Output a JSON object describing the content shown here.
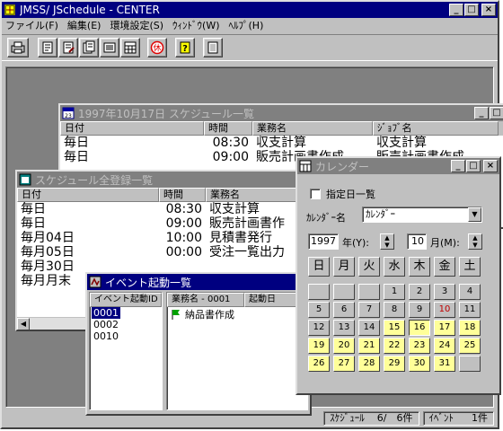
{
  "app": {
    "title": "JMSS/ JSchedule - CENTER",
    "menu": [
      "ファイル(F)",
      "編集(E)",
      "環境設定(S)",
      "ｳｨﾝﾄﾞｳ(W)",
      "ﾍﾙﾌﾟ(H)"
    ],
    "toolbar_icons": [
      "print-icon",
      "new-schedule-icon",
      "edit-schedule-icon",
      "list-schedule-icon",
      "register-icon",
      "calendar-icon",
      "holiday-icon",
      "help-icon",
      "memo-icon"
    ]
  },
  "schedule_list": {
    "title": "1997年10月17日 スケジュール一覧",
    "columns": [
      "日付",
      "時間",
      "業務名",
      "ｼﾞｮﾌﾞ名"
    ],
    "rows": [
      {
        "date": "毎日",
        "time": "08:30",
        "task": "収支計算",
        "job": "収支計算"
      },
      {
        "date": "毎日",
        "time": "09:00",
        "task": "販売計画書作成",
        "job": "販売計画書作成"
      }
    ]
  },
  "all_schedules": {
    "title": "スケジュール全登録一覧",
    "columns": [
      "日付",
      "時間",
      "業務名"
    ],
    "rows": [
      {
        "date": "毎日",
        "time": "08:30",
        "task": "収支計算"
      },
      {
        "date": "毎日",
        "time": "09:00",
        "task": "販売計画書作"
      },
      {
        "date": "毎月04日",
        "time": "10:00",
        "task": "見積書発行"
      },
      {
        "date": "毎月05日",
        "time": "00:00",
        "task": "受注一覧出力"
      },
      {
        "date": "毎月30日",
        "time": "",
        "task": ""
      },
      {
        "date": "毎月月末",
        "time": "",
        "task": ""
      }
    ]
  },
  "event_list": {
    "title": "イベント起動一覧",
    "id_header": "イベント起動ID",
    "ids": [
      "0001",
      "0002",
      "0010"
    ],
    "task_header": "業務名 - 0001",
    "start_header": "起動日",
    "tasks": [
      "納品書作成"
    ]
  },
  "calendar": {
    "title": "カレンダー",
    "specific_day_label": "指定日一覧",
    "calendar_name_label": "ｶﾚﾝﾀﾞｰ名",
    "calendar_name_value": "ｶﾚﾝﾀﾞｰ",
    "year_value": "1997",
    "year_label": "年(Y):",
    "month_value": "10",
    "month_label": "月(M):",
    "weekdays": [
      "日",
      "月",
      "火",
      "水",
      "木",
      "金",
      "土"
    ],
    "days": [
      "",
      "",
      "",
      "1",
      "2",
      "3",
      "4",
      "5",
      "6",
      "7",
      "8",
      "9",
      "10",
      "11",
      "12",
      "13",
      "14",
      "15",
      "16",
      "17",
      "18",
      "19",
      "20",
      "21",
      "22",
      "23",
      "24",
      "25",
      "26",
      "27",
      "28",
      "29",
      "30",
      "31",
      ""
    ],
    "highlighted_from": 15,
    "today": 16,
    "red_day": 10,
    "highlight_color": "#ffff99"
  },
  "status_bar": {
    "schedule_label": "ｽｹｼﾞｭｰﾙ",
    "schedule_count": "6/　6件",
    "event_label": "ｲﾍﾞﾝﾄ",
    "event_count": "1件"
  }
}
